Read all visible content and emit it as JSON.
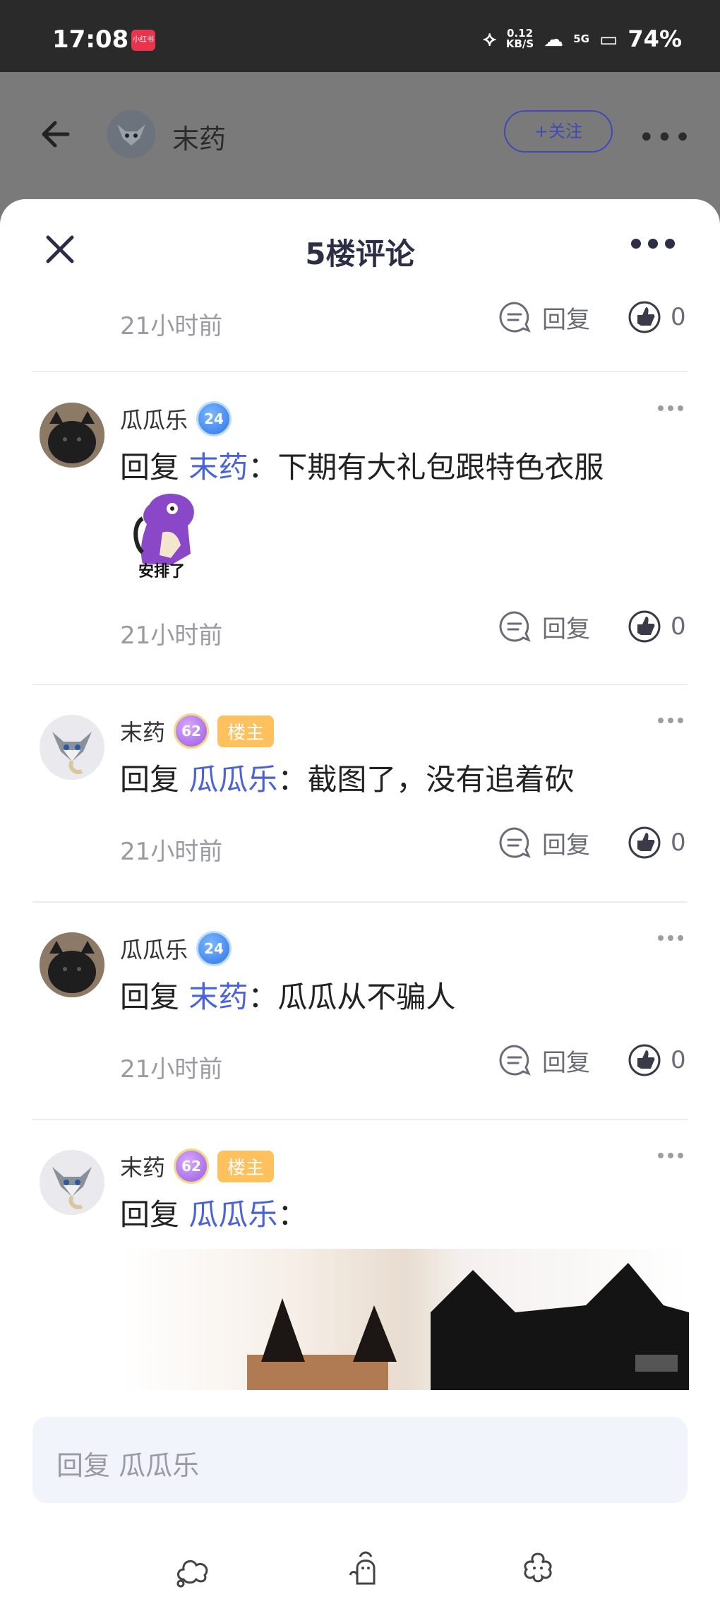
{
  "status_bar": {
    "time": "17:08",
    "app_badge": "小红书",
    "net_speed_top": "0.12",
    "net_speed_unit": "KB/S",
    "signal": "5G",
    "battery": "74%"
  },
  "background_header": {
    "user_name": "末药",
    "follow_label": "+关注"
  },
  "sheet": {
    "title": "5楼评论"
  },
  "labels": {
    "reply": "回复",
    "reply_prefix": "回复 "
  },
  "top_meta": {
    "time": "21小时前",
    "likes": "0"
  },
  "comments": [
    {
      "user": "瓜瓜乐",
      "level": "24",
      "level_color": "#2f74e6",
      "is_host": false,
      "reply_to": "末药",
      "text": "：下期有大礼包跟特色衣服",
      "sticker_caption": "安排了",
      "time": "21小时前",
      "likes": "0"
    },
    {
      "user": "末药",
      "level": "62",
      "level_color": "#9a5ae0",
      "is_host": true,
      "host_label": "楼主",
      "reply_to": "瓜瓜乐",
      "text": "：截图了，没有追着砍",
      "time": "21小时前",
      "likes": "0"
    },
    {
      "user": "瓜瓜乐",
      "level": "24",
      "level_color": "#2f74e6",
      "is_host": false,
      "reply_to": "末药",
      "text": "：瓜瓜从不骗人",
      "time": "21小时前",
      "likes": "0"
    },
    {
      "user": "末药",
      "level": "62",
      "level_color": "#9a5ae0",
      "is_host": true,
      "host_label": "楼主",
      "reply_to": "瓜瓜乐",
      "text": "：",
      "has_image": true
    }
  ],
  "input": {
    "placeholder": "回复 瓜瓜乐"
  },
  "icons": {
    "back": "arrow-left-icon",
    "close": "close-icon",
    "more": "more-dots-icon",
    "reply": "chat-bubble-icon",
    "like": "thumbs-up-icon",
    "emoji_cloud": "cloud-icon",
    "emoji_character": "character-icon",
    "emoji_flower": "flower-icon"
  }
}
